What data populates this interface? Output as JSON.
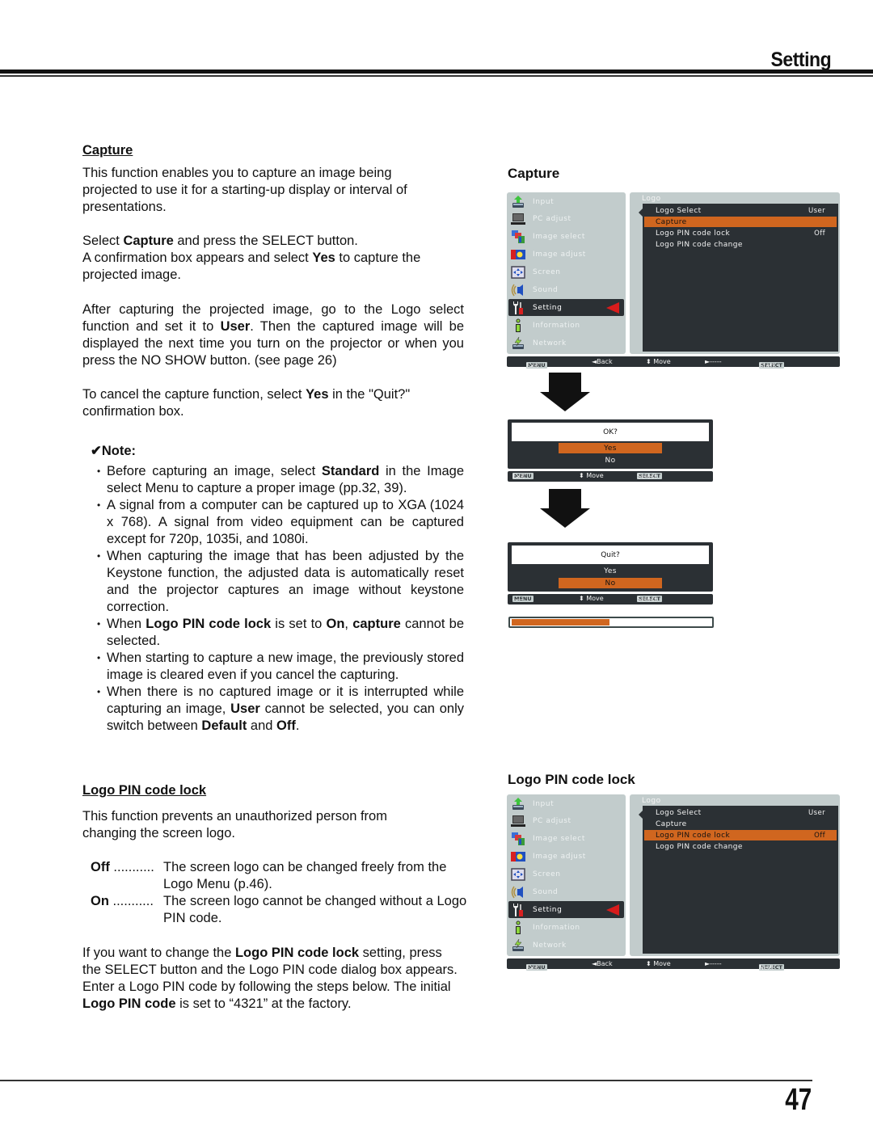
{
  "header": {
    "section_title": "Setting"
  },
  "footer": {
    "page_number": "47"
  },
  "capture_section": {
    "heading": "Capture",
    "intro": "This function enables you to capture an image being projected to use it for a starting-up display or interval of presentations.",
    "step1_pre": "Select ",
    "step1_bold": "Capture",
    "step1_post": " and press the SELECT button.",
    "step2_pre": "A confirmation box appears and select ",
    "step2_bold": "Yes",
    "step2_post": " to capture the projected image.",
    "after_pre": "After capturing the projected image, go to the Logo select function and set it to ",
    "after_bold": "User",
    "after_post": ". Then the captured image will be displayed the next time you turn on the projector or when you press the NO SHOW button. (see page 26)",
    "cancel_pre": "To cancel the capture function, select ",
    "cancel_bold": "Yes",
    "cancel_post": " in the \"Quit?\" confirmation box.",
    "note_heading": "✔Note:",
    "notes": [
      {
        "pre": "Before capturing an image, select ",
        "bold": "Standard",
        "post": " in the Image select Menu to capture a proper image (pp.32, 39)."
      },
      {
        "text": "A signal from a computer can be captured up to XGA (1024 x 768). A signal from video equipment can be captured except for 720p, 1035i, and 1080i."
      },
      {
        "text": "When capturing the image that has been adjusted by the Keystone function, the adjusted data is automatically reset and the projector captures an image without keystone correction."
      },
      {
        "pre": "When ",
        "bold": "Logo PIN code lock",
        "mid": " is set to ",
        "bold2": "On",
        "mid2": ", ",
        "bold3": "capture",
        "post": " cannot be selected."
      },
      {
        "text": "When starting to capture a new image, the previously stored image is cleared even if you cancel the capturing."
      },
      {
        "pre": "When there is no captured image or it is interrupted while capturing an image, ",
        "bold": "User",
        "mid": " cannot be selected, you can only switch between ",
        "bold2": "Default",
        "mid2": " and ",
        "bold3": "Off",
        "post": "."
      }
    ]
  },
  "pin_section": {
    "heading": "Logo PIN code lock",
    "intro": "This function prevents an unauthorized person from changing the screen logo.",
    "options": [
      {
        "term": "Off",
        "dots": " ...........",
        "desc": "The screen logo can be changed freely from the Logo Menu (p.46)."
      },
      {
        "term": "On",
        "dots": " ...........",
        "desc": "The screen logo cannot be changed without a Logo PIN code."
      }
    ],
    "change_pre": "If you want to change the ",
    "change_bold": "Logo PIN code lock",
    "change_mid": " setting, press the SELECT button and the Logo PIN code dialog box appears. Enter a Logo PIN code by following the steps below. The initial ",
    "change_bold2": "Logo PIN code",
    "change_post": " is set to “4321” at the factory."
  },
  "right_column": {
    "capture_heading": "Capture",
    "pin_heading": "Logo PIN code lock"
  },
  "osd_capture": {
    "sidebar": [
      {
        "label": "Input",
        "icon": "input-icon"
      },
      {
        "label": "PC adjust",
        "icon": "pc-adjust-icon"
      },
      {
        "label": "Image select",
        "icon": "image-select-icon"
      },
      {
        "label": "Image adjust",
        "icon": "image-adjust-icon"
      },
      {
        "label": "Screen",
        "icon": "screen-icon"
      },
      {
        "label": "Sound",
        "icon": "sound-icon"
      },
      {
        "label": "Setting",
        "icon": "setting-icon",
        "active": true
      },
      {
        "label": "Information",
        "icon": "information-icon"
      },
      {
        "label": "Network",
        "icon": "network-icon"
      }
    ],
    "panel_title": "Logo",
    "items": [
      {
        "label": "Logo Select",
        "value": "User"
      },
      {
        "label": "Capture",
        "value": "",
        "selected": true
      },
      {
        "label": "Logo PIN code lock",
        "value": "Off"
      },
      {
        "label": "Logo PIN code change",
        "value": ""
      }
    ],
    "footer": {
      "exit_key": "MENU",
      "exit": "Exit",
      "back": "◄Back",
      "move": "⬍ Move",
      "next": "►-----",
      "select_key": "SELECT",
      "action": "Start"
    }
  },
  "dialog_ok": {
    "question": "OK?",
    "options": [
      {
        "label": "Yes",
        "selected": true
      },
      {
        "label": "No",
        "selected": false
      }
    ],
    "footer": {
      "exit_key": "MENU",
      "exit": "Exit",
      "move": "⬍ Move",
      "select_key": "SELECT",
      "select": "Select"
    }
  },
  "dialog_quit": {
    "question": "Quit?",
    "options": [
      {
        "label": "Yes",
        "selected": false
      },
      {
        "label": "No",
        "selected": true
      }
    ],
    "footer": {
      "exit_key": "MENU",
      "exit": "-----",
      "move": "⬍ Move",
      "select_key": "SELECT",
      "select": "Select"
    }
  },
  "capture_progress": {
    "percent": 49,
    "color": "#d0661f"
  },
  "osd_pin": {
    "sidebar": [
      {
        "label": "Input",
        "icon": "input-icon"
      },
      {
        "label": "PC adjust",
        "icon": "pc-adjust-icon"
      },
      {
        "label": "Image select",
        "icon": "image-select-icon"
      },
      {
        "label": "Image adjust",
        "icon": "image-adjust-icon"
      },
      {
        "label": "Screen",
        "icon": "screen-icon"
      },
      {
        "label": "Sound",
        "icon": "sound-icon"
      },
      {
        "label": "Setting",
        "icon": "setting-icon",
        "active": true
      },
      {
        "label": "Information",
        "icon": "information-icon"
      },
      {
        "label": "Network",
        "icon": "network-icon"
      }
    ],
    "panel_title": "Logo",
    "items": [
      {
        "label": "Logo Select",
        "value": "User"
      },
      {
        "label": "Capture",
        "value": ""
      },
      {
        "label": "Logo PIN code lock",
        "value": "Off",
        "selected": true
      },
      {
        "label": "Logo PIN code change",
        "value": ""
      }
    ],
    "footer": {
      "exit_key": "MENU",
      "exit": "Exit",
      "back": "◄Back",
      "move": "⬍ Move",
      "next": "►-----",
      "select_key": "SELECT",
      "action": "Next"
    }
  },
  "colors": {
    "highlight": "#d0661f",
    "osd_dark": "#2b3034",
    "osd_light": "#c2cccc",
    "active_arrow": "#d81c1c"
  }
}
